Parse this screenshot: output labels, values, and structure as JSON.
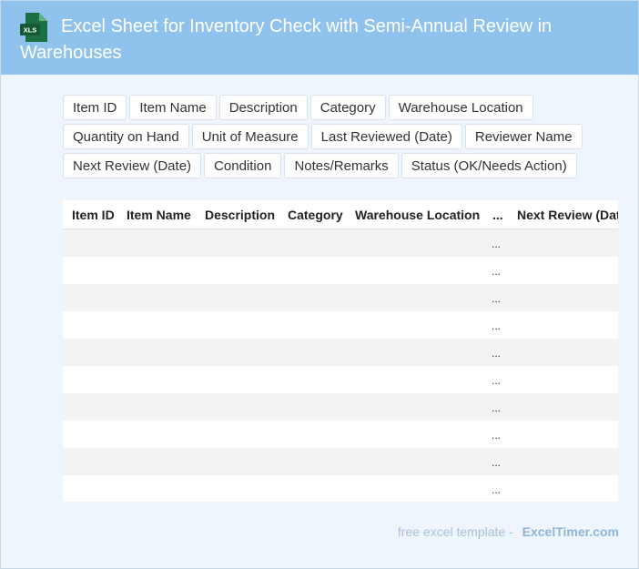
{
  "header": {
    "title": "Excel Sheet for Inventory Check with Semi-Annual Review in Warehouses",
    "icon_label": "XLS",
    "background": "#8fc3ee",
    "icon_color": "#1d7044"
  },
  "tags": [
    "Item ID",
    "Item Name",
    "Description",
    "Category",
    "Warehouse Location",
    "Quantity on Hand",
    "Unit of Measure",
    "Last Reviewed (Date)",
    "Reviewer Name",
    "Next Review (Date)",
    "Condition",
    "Notes/Remarks",
    "Status (OK/Needs Action)"
  ],
  "table": {
    "columns": [
      "Item ID",
      "Item Name",
      "Description",
      "Category",
      "Warehouse Location",
      "...",
      "Next Review (Date)"
    ],
    "rows": [
      [
        "",
        "",
        "",
        "",
        "",
        "...",
        ""
      ],
      [
        "",
        "",
        "",
        "",
        "",
        "...",
        ""
      ],
      [
        "",
        "",
        "",
        "",
        "",
        "...",
        ""
      ],
      [
        "",
        "",
        "",
        "",
        "",
        "...",
        ""
      ],
      [
        "",
        "",
        "",
        "",
        "",
        "...",
        ""
      ],
      [
        "",
        "",
        "",
        "",
        "",
        "...",
        ""
      ],
      [
        "",
        "",
        "",
        "",
        "",
        "...",
        ""
      ],
      [
        "",
        "",
        "",
        "",
        "",
        "...",
        ""
      ],
      [
        "",
        "",
        "",
        "",
        "",
        "...",
        ""
      ],
      [
        "",
        "",
        "",
        "",
        "",
        "...",
        ""
      ]
    ]
  },
  "footer": {
    "prefix": "free excel template -",
    "brand": "ExcelTimer.com"
  }
}
